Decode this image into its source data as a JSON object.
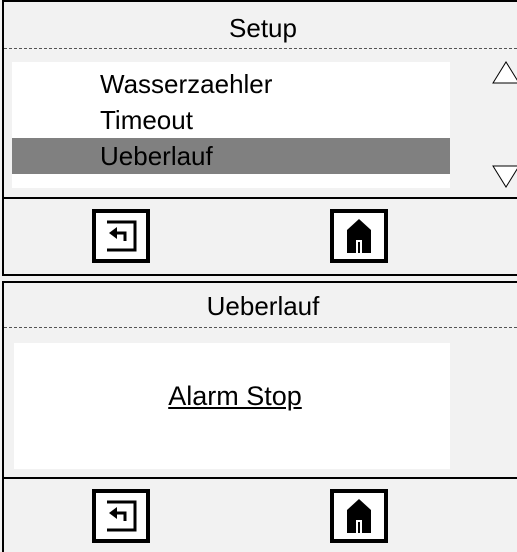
{
  "screen1": {
    "title": "Setup",
    "items": [
      {
        "label": "Wasserzaehler",
        "selected": false
      },
      {
        "label": "Timeout",
        "selected": false
      },
      {
        "label": "Ueberlauf",
        "selected": true
      }
    ],
    "scroll_up_icon": "triangle-up-icon",
    "scroll_down_icon": "triangle-down-icon",
    "back_icon": "back-arrow-icon",
    "home_icon": "home-icon"
  },
  "screen2": {
    "title": "Ueberlauf",
    "value": "Alarm Stop",
    "back_icon": "back-arrow-icon",
    "home_icon": "home-icon"
  },
  "colors": {
    "background": "#f2f2f2",
    "panel": "#ffffff",
    "selection": "#808080",
    "border": "#000000"
  }
}
